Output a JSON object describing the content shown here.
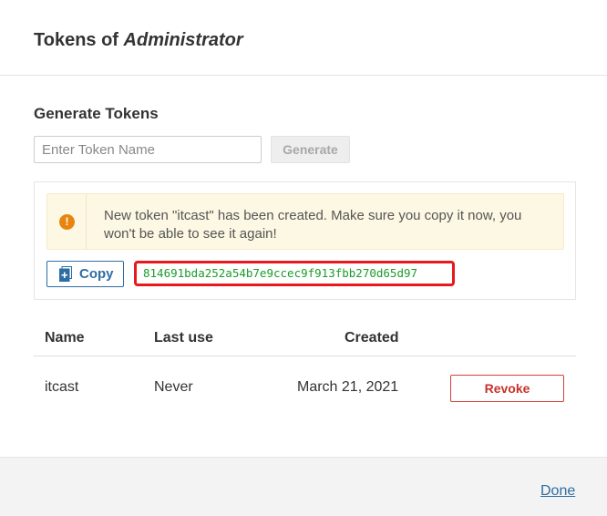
{
  "modal": {
    "title_prefix": "Tokens of ",
    "title_user": "Administrator"
  },
  "generate": {
    "section_title": "Generate Tokens",
    "input_placeholder": "Enter Token Name",
    "input_value": "",
    "button_label": "Generate"
  },
  "result": {
    "warning_text": "New token \"itcast\" has been created. Make sure you copy it now, you won't be able to see it again!",
    "copy_label": "Copy",
    "token_value": "814691bda252a54b7e9ccec9f913fbb270d65d97",
    "highlight_color": "#e8191c"
  },
  "table": {
    "headers": {
      "name": "Name",
      "last_use": "Last use",
      "created": "Created"
    },
    "rows": [
      {
        "name": "itcast",
        "last_use": "Never",
        "created": "March 21, 2021",
        "action_label": "Revoke"
      }
    ]
  },
  "footer": {
    "done_label": "Done"
  },
  "colors": {
    "link": "#2e6da4",
    "danger": "#d43f3a",
    "token_text": "#1a9c2a",
    "warning_bg": "#fcf8e3",
    "warning_icon": "#e8850e"
  },
  "icons": {
    "warning": "exclamation-circle-icon",
    "copy": "copy-document-icon"
  }
}
